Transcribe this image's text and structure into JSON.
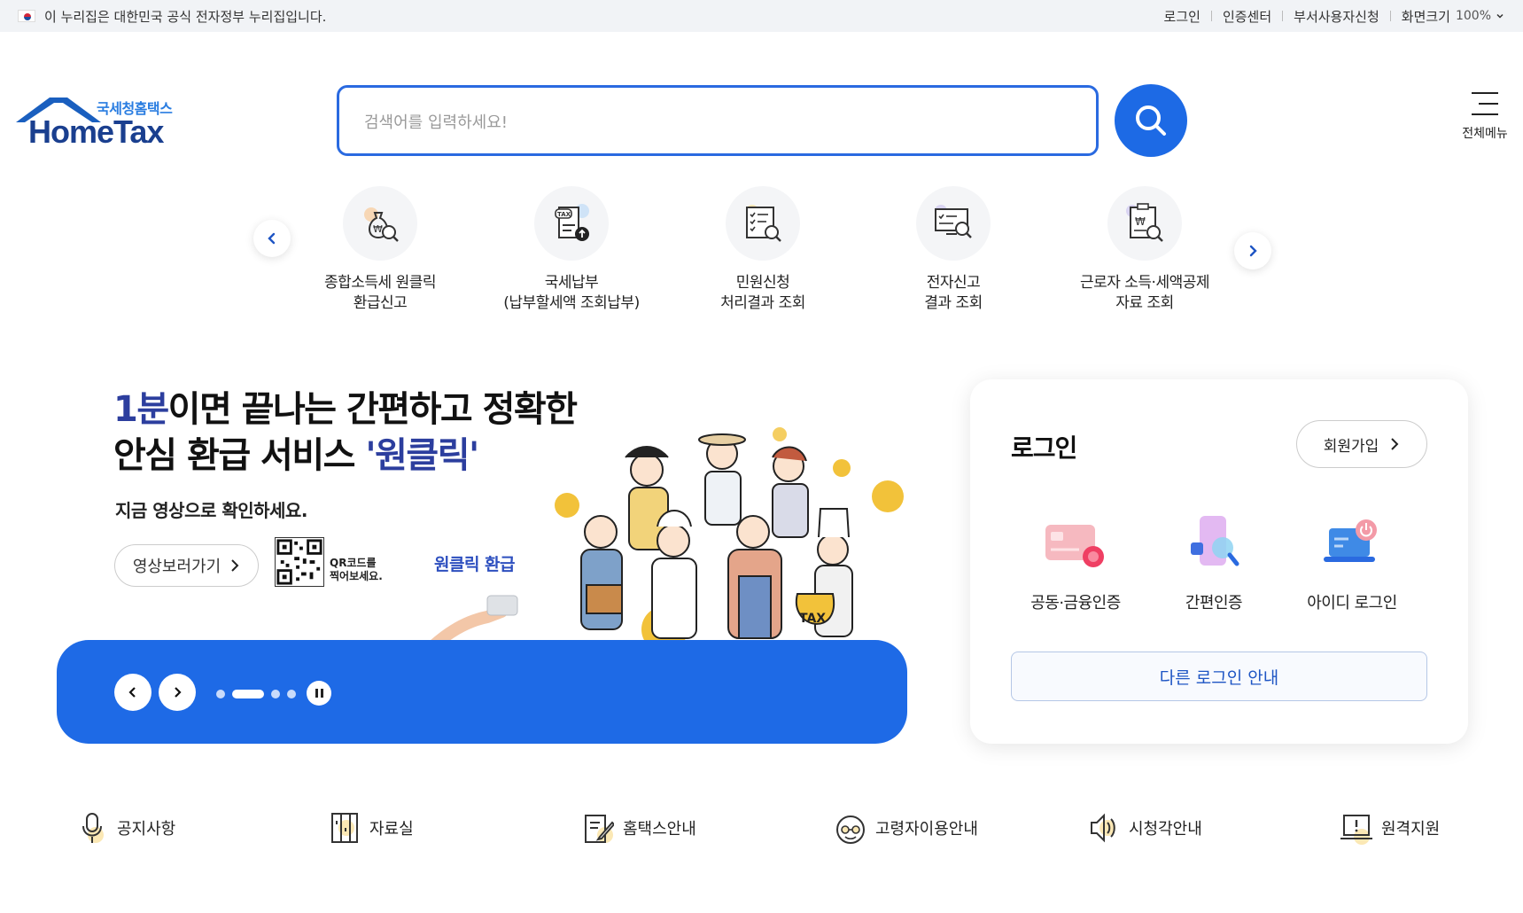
{
  "topbar": {
    "gov_notice": "이 누리집은 대한민국 공식 전자정부 누리집입니다.",
    "links": [
      "로그인",
      "인증센터",
      "부서사용자신청",
      "화면크기"
    ],
    "zoom": "100%"
  },
  "header": {
    "logo_sub": "국세청홈택스",
    "logo_main": "HomeTax",
    "search_placeholder": "검색어를 입력하세요!",
    "all_menu_label": "전체메뉴"
  },
  "quick_menu": [
    {
      "line1": "종합소득세 원클릭",
      "line2": "환급신고",
      "icon": "money-bag-search-icon"
    },
    {
      "line1": "국세납부",
      "line2": "(납부할세액 조회납부)",
      "icon": "tax-document-upload-icon"
    },
    {
      "line1": "민원신청",
      "line2": "처리결과 조회",
      "icon": "checklist-search-icon"
    },
    {
      "line1": "전자신고",
      "line2": "결과 조회",
      "icon": "monitor-search-icon"
    },
    {
      "line1": "근로자 소득·세액공제",
      "line2": "자료 조회",
      "icon": "clipboard-won-search-icon"
    }
  ],
  "banner": {
    "title_hl": "1분",
    "title_rest1": "이면 끝나는 간편하고 정확한",
    "title_line2_a": "안심 환급 서비스 ",
    "title_line2_hl": "'원클릭'",
    "subtitle": "지금 영상으로 확인하세요.",
    "video_button": "영상보러가기",
    "qr_text_1": "QR코드를",
    "qr_text_2": "찍어보세요.",
    "badge": "원클릭 환급"
  },
  "login": {
    "title": "로그인",
    "join_button": "회원가입",
    "options": [
      {
        "label": "공동·금융인증",
        "icon": "certificate-card-icon"
      },
      {
        "label": "간편인증",
        "icon": "phone-search-icon"
      },
      {
        "label": "아이디 로그인",
        "icon": "laptop-power-icon"
      }
    ],
    "other_login": "다른 로그인 안내"
  },
  "bottom_menu": [
    {
      "label": "공지사항",
      "icon": "microphone-icon"
    },
    {
      "label": "자료실",
      "icon": "archive-icon"
    },
    {
      "label": "홈택스안내",
      "icon": "document-pen-icon"
    },
    {
      "label": "고령자이용안내",
      "icon": "elderly-face-icon"
    },
    {
      "label": "시청각안내",
      "icon": "speaker-icon"
    },
    {
      "label": "원격지원",
      "icon": "remote-laptop-icon"
    }
  ],
  "colors": {
    "brand_blue": "#1e6ae6",
    "logo_navy": "#1a3f8f",
    "highlight": "#2c3e9e"
  }
}
